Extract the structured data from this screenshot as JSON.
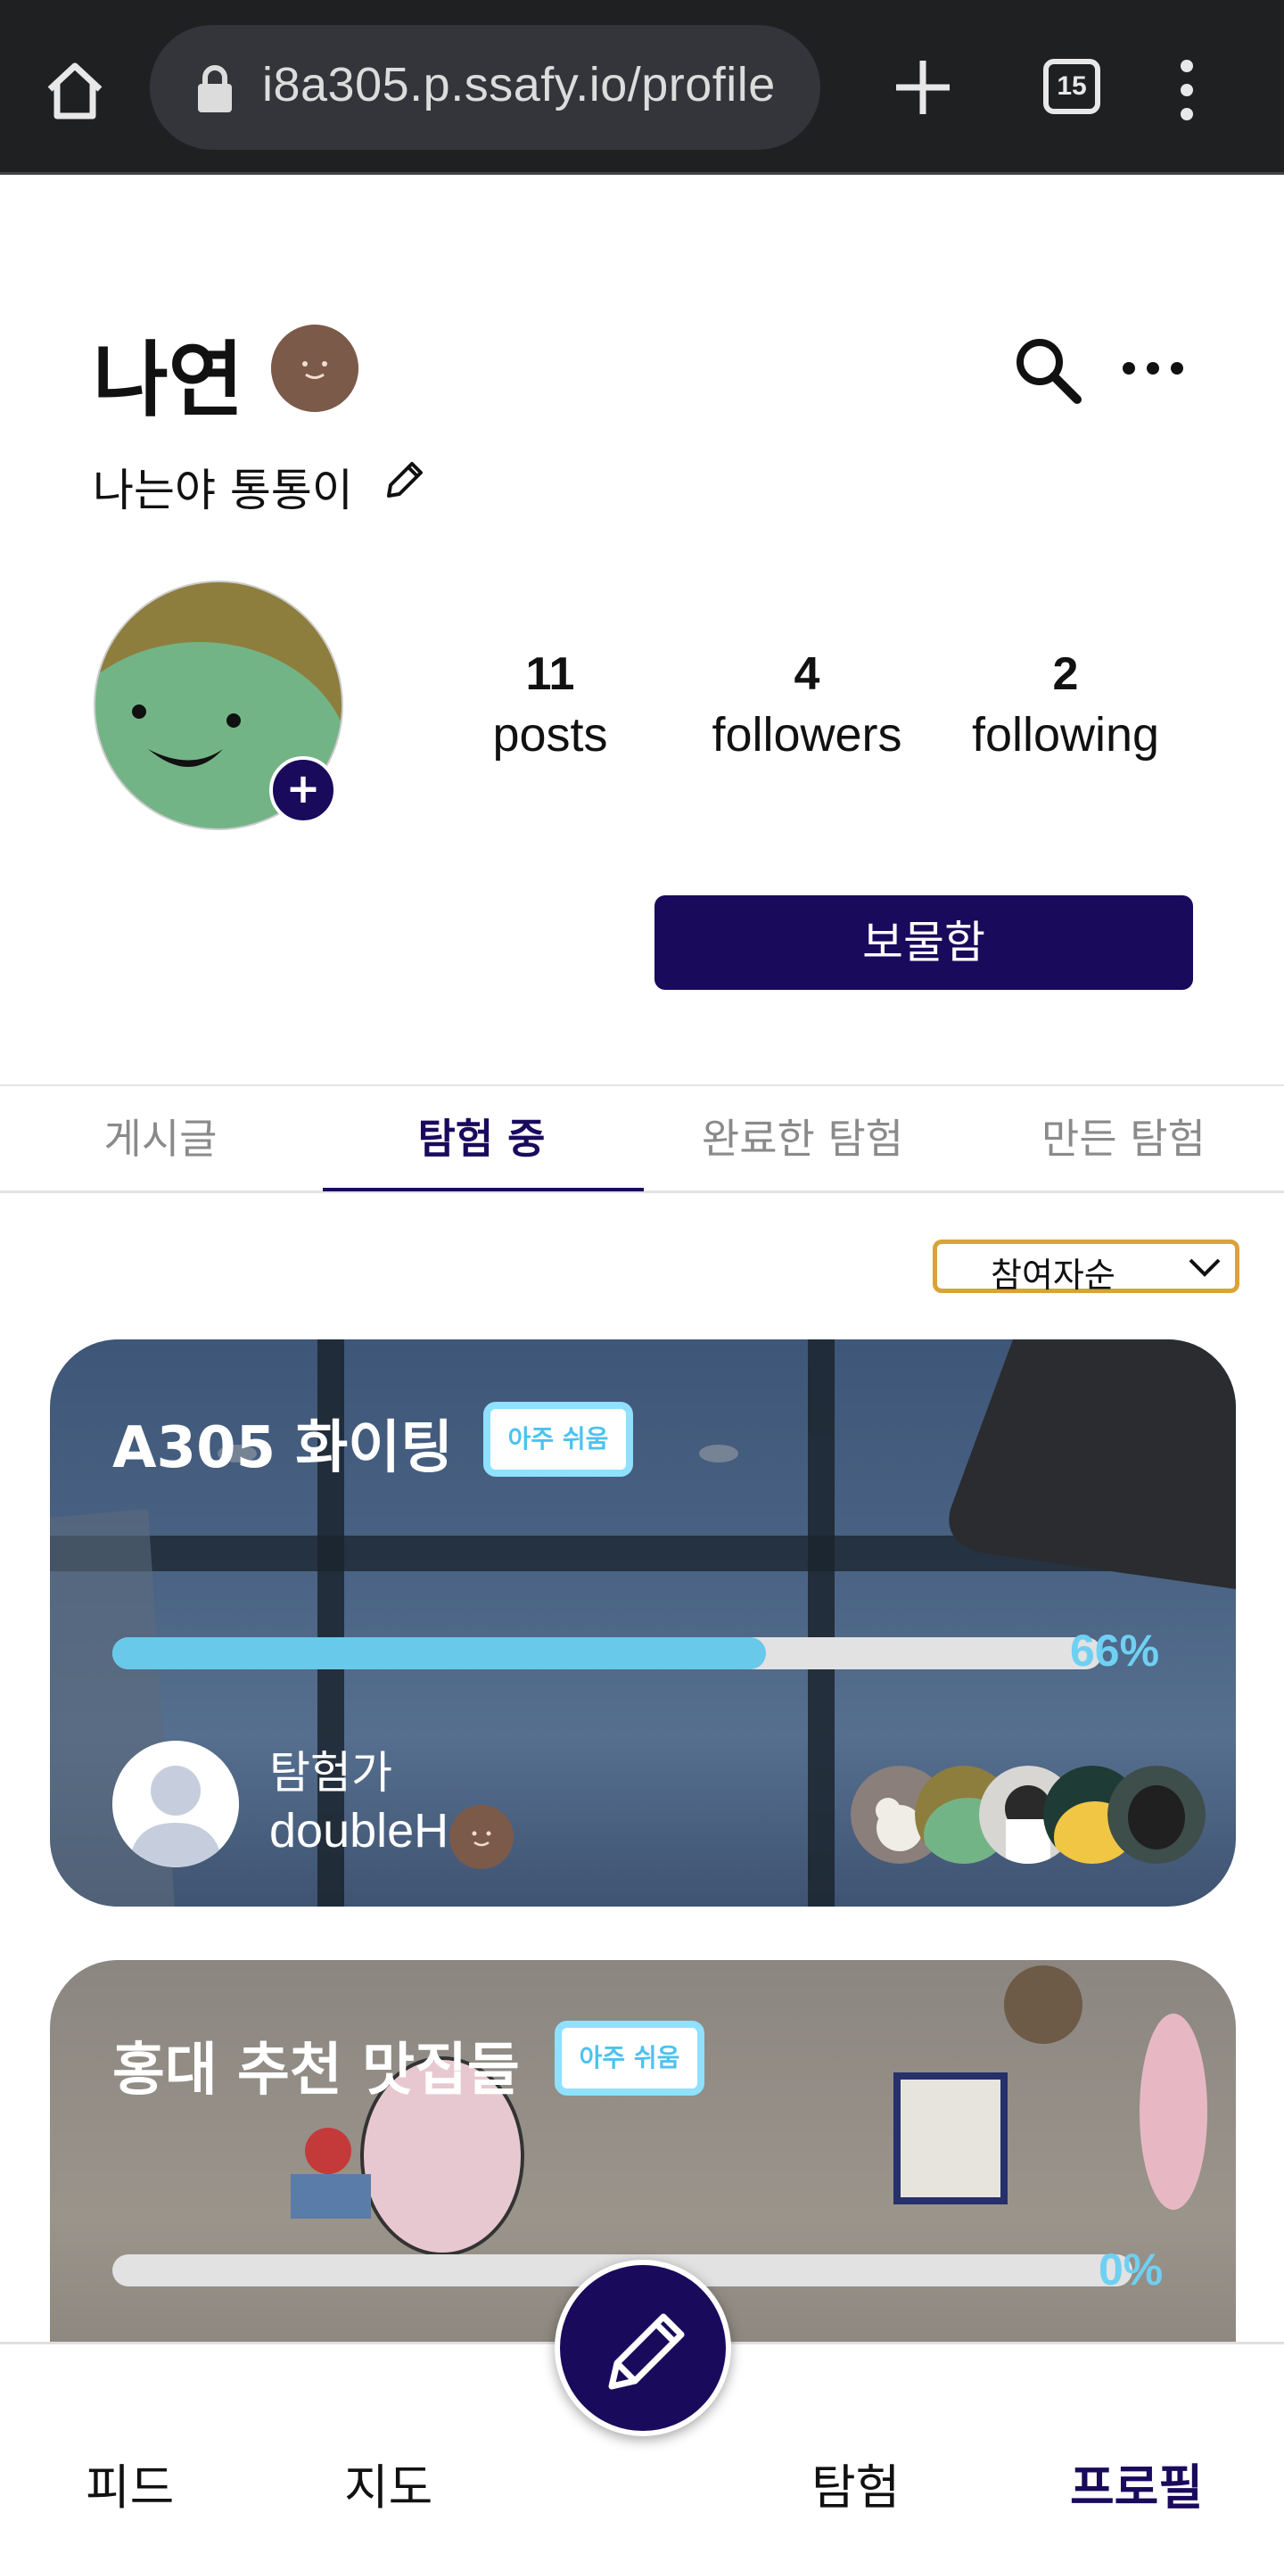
{
  "browser": {
    "url": "i8a305.p.ssafy.io/profile",
    "tab_count": "15"
  },
  "profile": {
    "name": "나연",
    "bio": "나는야 통통이",
    "stats": [
      {
        "value": "11",
        "label": "posts"
      },
      {
        "value": "4",
        "label": "followers"
      },
      {
        "value": "2",
        "label": "following"
      }
    ],
    "treasure_button": "보물함"
  },
  "tabs": [
    {
      "label": "게시글",
      "active": false
    },
    {
      "label": "탐험 중",
      "active": true
    },
    {
      "label": "완료한 탐험",
      "active": false
    },
    {
      "label": "만든 탐험",
      "active": false
    }
  ],
  "sort": {
    "selected": "참여자순"
  },
  "cards": [
    {
      "title": "A305 화이팅",
      "difficulty": "아주 쉬움",
      "progress_percent": 66,
      "progress_label": "66%",
      "leader_role": "탐험가",
      "leader_name": "doubleH",
      "member_count_shown": 5
    },
    {
      "title": "홍대 추천 맛집들",
      "difficulty": "아주 쉬움",
      "progress_percent": 0,
      "progress_label": "0%"
    }
  ],
  "bottom_nav": {
    "items": [
      {
        "label": "피드",
        "active": false
      },
      {
        "label": "지도",
        "active": false
      },
      {
        "label": "탐험",
        "active": false
      },
      {
        "label": "프로필",
        "active": true
      }
    ]
  },
  "colors": {
    "brand": "#1a0a5c",
    "progress": "#68c9ea",
    "sort_border": "#d9a33a",
    "badge_border": "#8fe1ff"
  },
  "icons": {
    "browser": [
      "home-icon",
      "lock-icon",
      "plus-icon",
      "tabs-icon",
      "menu-icon"
    ],
    "header": [
      "search-icon",
      "more-icon",
      "edit-icon"
    ],
    "fab": "pencil-icon"
  }
}
